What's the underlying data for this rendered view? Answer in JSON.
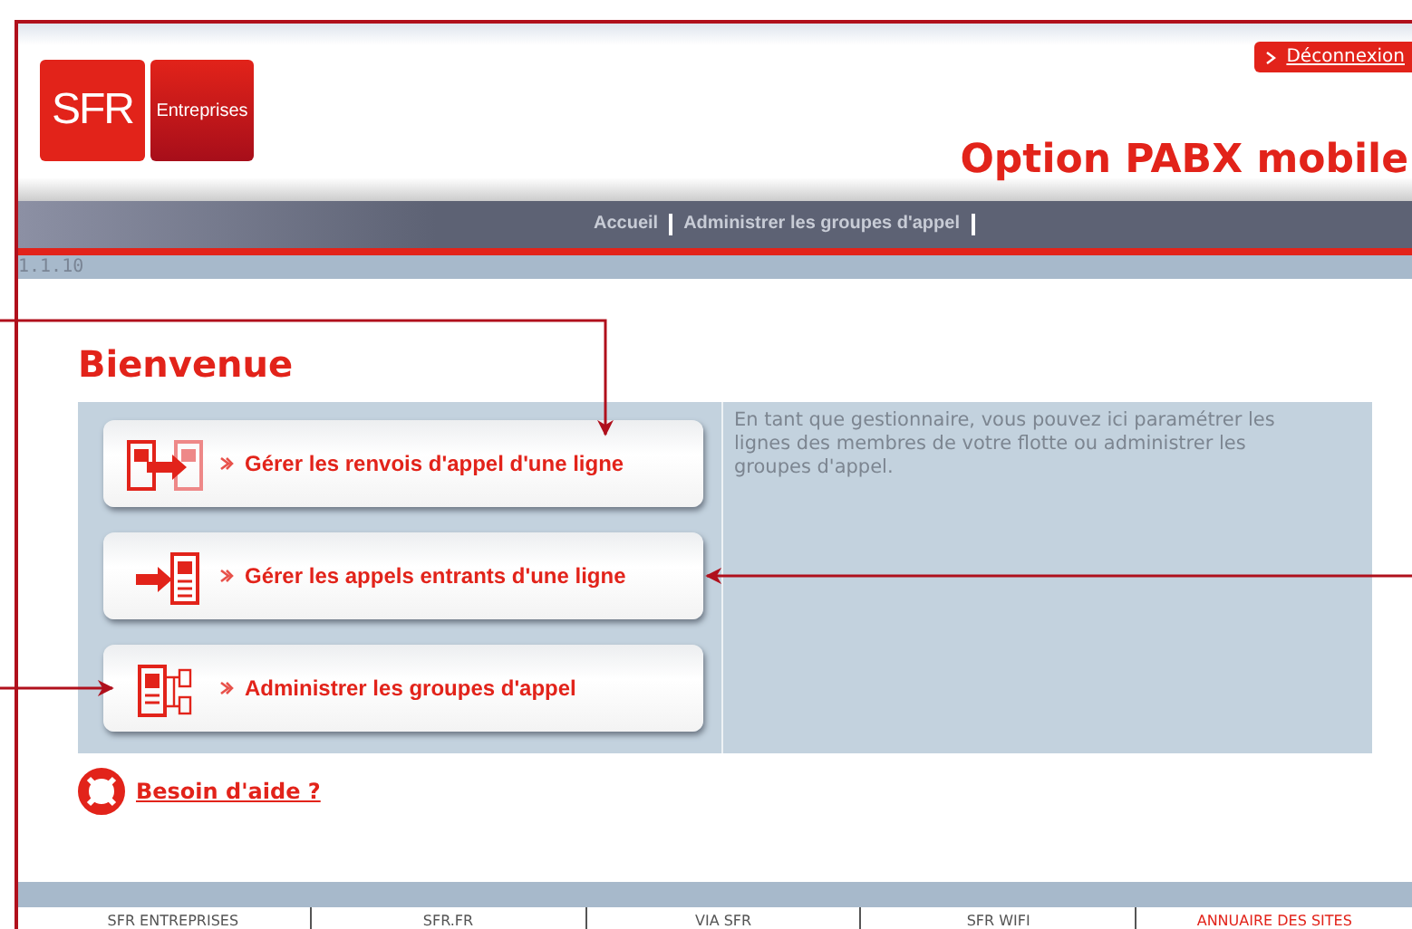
{
  "header": {
    "logo": {
      "brand": "SFR",
      "sub": "Entreprises"
    },
    "logout_link": "Déconnexion",
    "title": "Option PABX mobile"
  },
  "nav": {
    "items": [
      "Accueil",
      "Administrer les groupes d'appel"
    ]
  },
  "version": "1.1.10",
  "heading": "Bienvenue",
  "actions": [
    {
      "kind": "forward",
      "label": "Gérer les renvois d'appel d'une ligne"
    },
    {
      "kind": "incoming",
      "label": "Gérer les appels entrants d'une ligne"
    },
    {
      "kind": "groups",
      "label": "Administrer les groupes d'appel"
    }
  ],
  "description": "En tant que gestionnaire, vous pouvez ici paramétrer les lignes des membres de votre flotte ou administrer les groupes d'appel.",
  "help_link": "Besoin d'aide ?",
  "footer": {
    "links": [
      {
        "label": "SFR ENTREPRISES",
        "selected": false
      },
      {
        "label": "SFR.FR",
        "selected": false
      },
      {
        "label": "VIA SFR",
        "selected": false
      },
      {
        "label": "SFR WIFI",
        "selected": false
      },
      {
        "label": "ANNUAIRE DES SITES",
        "selected": true
      }
    ]
  }
}
